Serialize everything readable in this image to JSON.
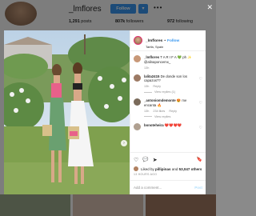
{
  "profile": {
    "username": "_lmflores",
    "follow_label": "Follow",
    "posts": "1,291",
    "posts_label": "posts",
    "followers": "807k",
    "followers_label": "followers",
    "following": "972",
    "following_label": "following"
  },
  "post": {
    "header": {
      "username": "_lmflores",
      "separator": "•",
      "follow_label": "Follow",
      "location": "Tarifa, Spain"
    },
    "comments": [
      {
        "username": "_lmflores",
        "text": "T A R I F A 💚 ph ✨ @alinaponcemx_",
        "meta": [
          "13h"
        ]
      },
      {
        "username": "lalita2415",
        "text": "De donde son los capazos??",
        "meta": [
          "13h",
          "Reply"
        ],
        "view_replies": "View replies (1)"
      },
      {
        "username": "_antoniomdemonte",
        "text": "😍 me encanta 🔥",
        "meta": [
          "13h",
          "234 likes",
          "Reply"
        ],
        "view_replies": "View replies"
      },
      {
        "username": "bonoteheira",
        "text": "❤️❤️❤️❤️",
        "meta": []
      }
    ],
    "actions": {
      "like_icon": "♡",
      "comment_icon": "💬",
      "share_icon": "➤",
      "save_icon": "🔖"
    },
    "liked_by_prefix": "Liked by",
    "liked_by_user": "pillipinas",
    "liked_by_and": "and",
    "liked_by_others": "53,047 others",
    "timestamp": "13 HOURS AGO",
    "add_comment_placeholder": "Add a comment...",
    "post_label": "Post"
  },
  "icons": {
    "close": "✕",
    "next": "›",
    "more": "•••",
    "heart_small": "♡"
  },
  "colors": {
    "accent": "#3897f0",
    "text": "#262626",
    "muted": "#8e8e8e"
  }
}
